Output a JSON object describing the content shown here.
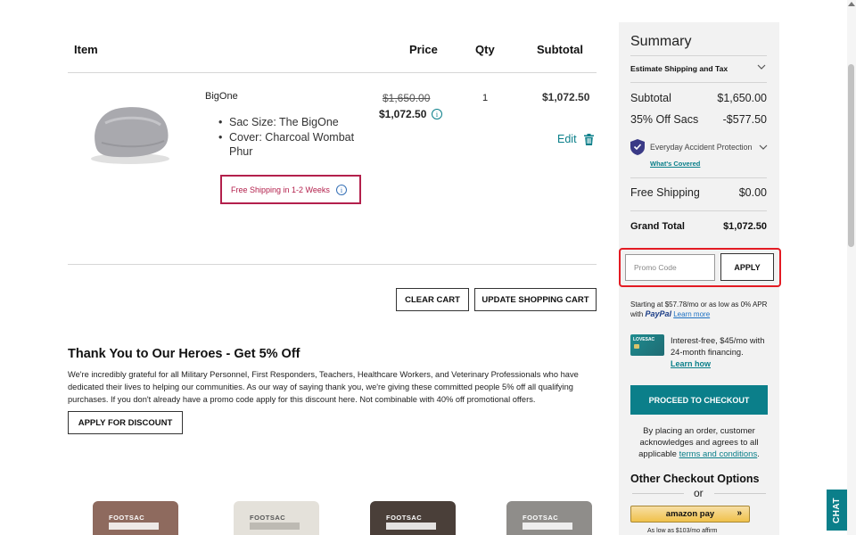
{
  "cart": {
    "headers": {
      "item": "Item",
      "price": "Price",
      "qty": "Qty",
      "subtotal": "Subtotal"
    },
    "line_item": {
      "name": "BigOne",
      "options": [
        "Sac Size: The BigOne",
        "Cover: Charcoal Wombat Phur"
      ],
      "shipping_note": "Free Shipping in 1-2 Weeks",
      "original_price": "$1,650.00",
      "sale_price": "$1,072.50",
      "qty": "1",
      "subtotal": "$1,072.50",
      "edit_label": "Edit"
    },
    "clear_label": "CLEAR CART",
    "update_label": "UPDATE SHOPPING CART"
  },
  "heroes": {
    "title": "Thank You to Our Heroes - Get 5% Off",
    "body": "We're incredibly grateful for all Military Personnel, First Responders, Teachers, Healthcare Workers, and Veterinary Professionals who have dedicated their lives to helping our communities. As our way of saying thank you, we're giving these committed people 5% off all qualifying purchases. If you don't already have a promo code apply for this discount here. Not combinable with 40% off promotional offers.",
    "button_label": "APPLY FOR DISCOUNT"
  },
  "thumbs": [
    {
      "label": "FOOTSAC",
      "color": "#8e6a5e"
    },
    {
      "label": "FOOTSAC",
      "color": "#e4e1da"
    },
    {
      "label": "FOOTSAC",
      "color": "#4a3f39"
    },
    {
      "label": "FOOTSAC",
      "color": "#8f8d8a"
    }
  ],
  "summary": {
    "title": "Summary",
    "estimate_label": "Estimate Shipping and Tax",
    "subtotal_label": "Subtotal",
    "subtotal_value": "$1,650.00",
    "discount_label": "35% Off Sacs",
    "discount_value": "-$577.50",
    "protection_label": "Everyday Accident Protection",
    "whats_covered": "What's Covered",
    "shipping_label": "Free Shipping",
    "shipping_value": "$0.00",
    "grand_total_label": "Grand Total",
    "grand_total_value": "$1,072.50",
    "promo_placeholder": "Promo Code",
    "apply_label": "APPLY",
    "financing": {
      "pre": "Starting at $57.78/mo or as low as 0% APR with",
      "paypal": "PayPal",
      "learn_more": "Learn more"
    },
    "card_label": "LOVESAC",
    "interest_free": "Interest-free, $45/mo with 24-month financing.",
    "learn_how": "Learn how",
    "checkout_label": "PROCEED TO CHECKOUT",
    "agree_pre": "By placing an order, customer acknowledges and agrees to all applicable",
    "agree_link": "terms and conditions",
    "agree_post": ".",
    "other_options": "Other Checkout Options",
    "or": "or",
    "amazon_pay": "amazon pay",
    "as_low_as": "As low as $103/mo affirm"
  },
  "chat_label": "CHAT",
  "colors": {
    "teal": "#0b7f8a",
    "promo_highlight": "#e31b23",
    "shipping_red": "#b3204c"
  }
}
